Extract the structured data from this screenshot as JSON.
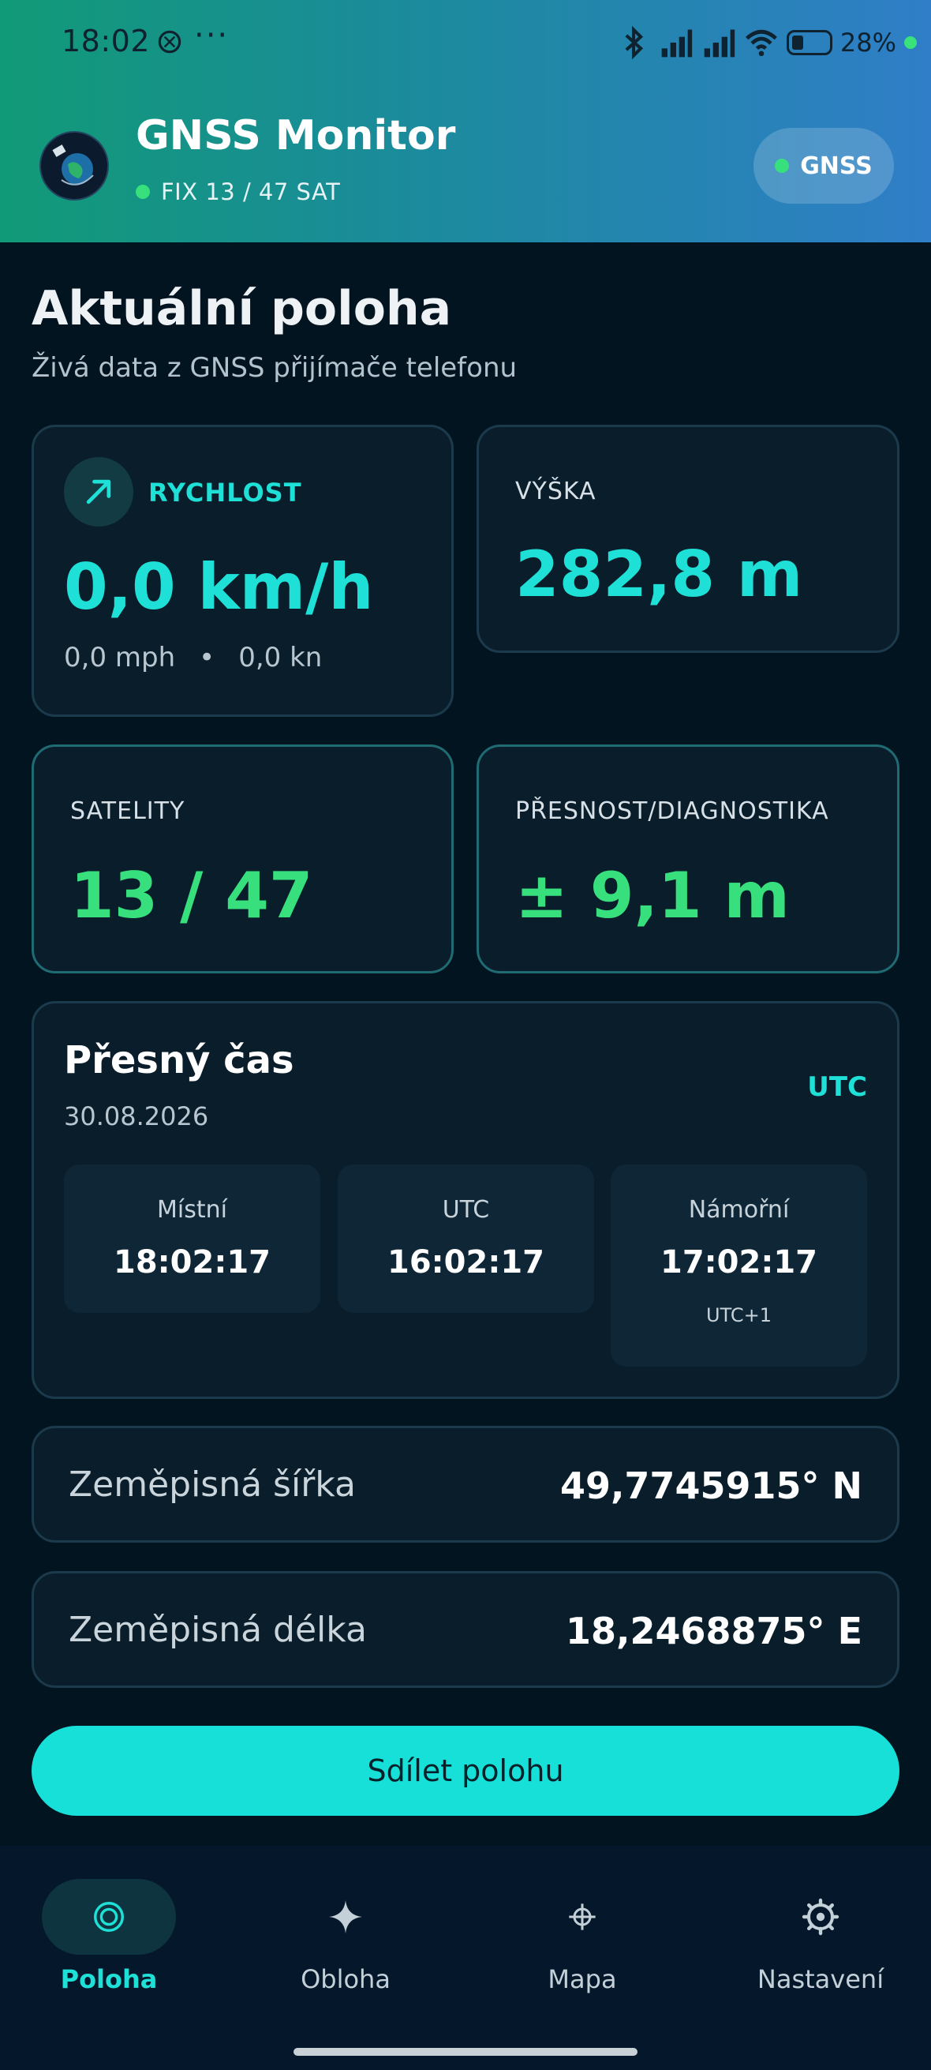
{
  "status_bar": {
    "time": "18:02",
    "dots": "···",
    "battery_pct": "28%"
  },
  "header": {
    "title": "GNSS Monitor",
    "fix_text": "FIX 13 / 47 SAT",
    "gnss_button": "GNSS"
  },
  "page": {
    "title": "Aktuální poloha",
    "subtitle": "Živá data z GNSS přijímače telefonu"
  },
  "speed": {
    "label": "RYCHLOST",
    "value": "0,0 km/h",
    "mph": "0,0 mph",
    "separator": "•",
    "knots": "0,0 kn"
  },
  "altitude": {
    "label": "VÝŠKA",
    "value": "282,8 m"
  },
  "satellites": {
    "label": "SATELITY",
    "value": "13 / 47"
  },
  "accuracy": {
    "label": "PŘESNOST/DIAGNOSTIKA",
    "value": "± 9,1 m"
  },
  "time_card": {
    "title": "Přesný čas",
    "date": "30.08.2026",
    "badge": "UTC",
    "boxes": [
      {
        "label": "Místní",
        "value": "18:02:17"
      },
      {
        "label": "UTC",
        "value": "16:02:17"
      },
      {
        "label": "Námořní",
        "value": "17:02:17",
        "sub": "UTC+1"
      }
    ]
  },
  "coordinates": {
    "lat_label": "Zeměpisná šířka",
    "lat_value": "49,7745915° N",
    "lon_label": "Zeměpisná délka",
    "lon_value": "18,2468875° E"
  },
  "share_button": "Sdílet polohu",
  "nav": [
    {
      "label": "Poloha",
      "icon": "target-icon",
      "active": true
    },
    {
      "label": "Obloha",
      "icon": "sparkle-icon",
      "active": false
    },
    {
      "label": "Mapa",
      "icon": "crosshair-icon",
      "active": false
    },
    {
      "label": "Nastavení",
      "icon": "gear-icon",
      "active": false
    }
  ],
  "colors": {
    "accent_cyan": "#1ee0d6",
    "accent_green": "#37e07c",
    "background": "#031421",
    "card": "#0a1d2b"
  }
}
